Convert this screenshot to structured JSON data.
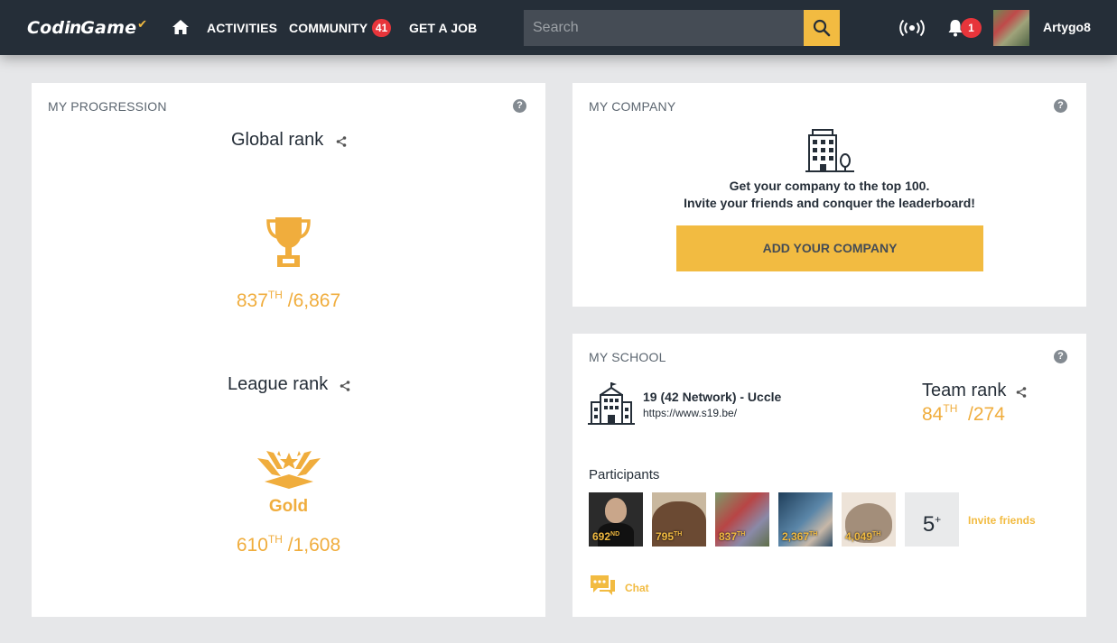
{
  "nav": {
    "logo_cod": "Cod",
    "logo_in": "in",
    "logo_game": "Game",
    "items": [
      "ACTIVITIES",
      "COMMUNITY",
      "GET A JOB"
    ],
    "community_badge": "41",
    "search_placeholder": "Search",
    "notifications_badge": "1",
    "username": "Artygo8"
  },
  "progression": {
    "title": "MY PROGRESSION",
    "global_rank_label": "Global rank",
    "global_rank": "837",
    "global_rank_suffix": "TH",
    "global_rank_total": "/6,867",
    "league_rank_label": "League rank",
    "league_name": "Gold",
    "league_rank": "610",
    "league_rank_suffix": "TH",
    "league_rank_total": "/1,608"
  },
  "company": {
    "title": "MY COMPANY",
    "line1": "Get your company to the top 100.",
    "line2": "Invite your friends and conquer the leaderboard!",
    "button": "ADD YOUR COMPANY"
  },
  "school": {
    "title": "MY SCHOOL",
    "name": "19 (42 Network) - Uccle",
    "url": "https://www.s19.be/",
    "team_rank_label": "Team rank",
    "team_rank": "84",
    "team_rank_suffix": "TH",
    "team_rank_total": "/274",
    "participants_label": "Participants",
    "participants": [
      {
        "rank": "692",
        "suffix": "ND",
        "bg": "#2b2b2b"
      },
      {
        "rank": "795",
        "suffix": "TH",
        "bg": "#8a6a4f"
      },
      {
        "rank": "837",
        "suffix": "TH",
        "bg": "#8b5a5a"
      },
      {
        "rank": "2,367",
        "suffix": "TH",
        "bg": "#3c5a78"
      },
      {
        "rank": "4,049",
        "suffix": "TH",
        "bg": "#b8a594"
      }
    ],
    "more": "5",
    "more_sup": "+",
    "invite": "Invite friends",
    "chat": "Chat"
  },
  "colors": {
    "accent": "#f2bb41",
    "nav_bg": "#252e38",
    "badge": "#e7353b"
  }
}
